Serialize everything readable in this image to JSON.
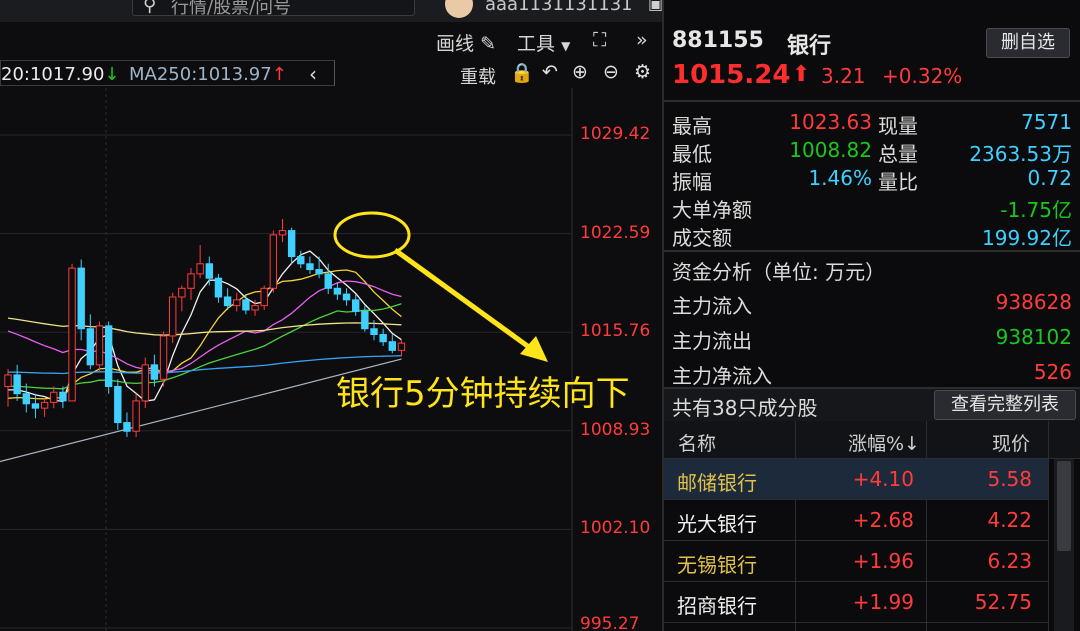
{
  "topbar": {
    "search_placeholder": "行情/股票/问号",
    "username": "aaa1131131131"
  },
  "toolbar": {
    "draw_label": "画线",
    "tools_label": "工具",
    "reload_label": "重载"
  },
  "ma": {
    "ma20_text": "20:1017.90",
    "ma20_arrow": "↓",
    "ma250_text": "MA250:1013.97",
    "ma250_arrow": "↑",
    "prev_icon": "chevron-left-icon"
  },
  "chart": {
    "price_labels": [
      "1029.42",
      "1022.59",
      "1015.76",
      "1008.93",
      "1002.10",
      "995.27"
    ],
    "annotation": "银行5分钟持续向下",
    "annotation_color": "#ffe41a",
    "up_color": "#ff3b3b",
    "down_color": "#3fd0ff"
  },
  "chart_data": {
    "type": "candlestick",
    "ylim": [
      995.27,
      1031.5
    ],
    "y_ticks": [
      1029.42,
      1022.59,
      1015.76,
      1008.93,
      1002.1,
      995.27
    ],
    "candles": [
      [
        1012.0,
        1013.2,
        1010.6,
        1012.8
      ],
      [
        1012.8,
        1013.5,
        1011.0,
        1011.5
      ],
      [
        1011.5,
        1012.2,
        1010.2,
        1010.8
      ],
      [
        1010.8,
        1011.5,
        1009.8,
        1010.5
      ],
      [
        1010.5,
        1011.2,
        1009.9,
        1010.9
      ],
      [
        1010.9,
        1012.0,
        1010.5,
        1011.6
      ],
      [
        1011.6,
        1012.0,
        1010.5,
        1011.0
      ],
      [
        1011.0,
        1020.5,
        1011.0,
        1020.2
      ],
      [
        1020.2,
        1020.8,
        1015.2,
        1016.0
      ],
      [
        1016.0,
        1017.0,
        1013.2,
        1013.5
      ],
      [
        1013.5,
        1016.5,
        1013.0,
        1016.2
      ],
      [
        1016.2,
        1016.5,
        1011.5,
        1012.0
      ],
      [
        1012.0,
        1012.5,
        1009.0,
        1009.5
      ],
      [
        1009.5,
        1010.2,
        1008.5,
        1008.9
      ],
      [
        1008.9,
        1011.5,
        1008.5,
        1011.0
      ],
      [
        1011.0,
        1014.0,
        1010.5,
        1013.5
      ],
      [
        1013.5,
        1014.2,
        1012.0,
        1012.5
      ],
      [
        1012.5,
        1015.8,
        1012.0,
        1015.5
      ],
      [
        1015.5,
        1018.5,
        1015.0,
        1018.2
      ],
      [
        1018.2,
        1019.0,
        1017.2,
        1018.8
      ],
      [
        1018.8,
        1020.2,
        1018.0,
        1019.8
      ],
      [
        1019.8,
        1021.8,
        1019.5,
        1020.5
      ],
      [
        1020.5,
        1021.0,
        1019.0,
        1019.5
      ],
      [
        1019.5,
        1019.8,
        1017.8,
        1018.2
      ],
      [
        1018.2,
        1018.8,
        1017.3,
        1017.6
      ],
      [
        1017.6,
        1018.5,
        1017.2,
        1018.0
      ],
      [
        1018.0,
        1018.4,
        1017.0,
        1017.3
      ],
      [
        1017.3,
        1018.0,
        1016.9,
        1017.6
      ],
      [
        1017.6,
        1019.0,
        1017.3,
        1018.8
      ],
      [
        1018.8,
        1022.8,
        1018.5,
        1022.5
      ],
      [
        1022.5,
        1023.6,
        1022.0,
        1022.8
      ],
      [
        1022.8,
        1023.0,
        1020.5,
        1021.0
      ],
      [
        1021.0,
        1021.4,
        1020.2,
        1020.5
      ],
      [
        1020.5,
        1021.0,
        1019.8,
        1020.1
      ],
      [
        1020.1,
        1021.0,
        1019.5,
        1019.8
      ],
      [
        1019.8,
        1020.5,
        1018.4,
        1018.8
      ],
      [
        1018.8,
        1019.2,
        1018.0,
        1018.4
      ],
      [
        1018.4,
        1018.8,
        1017.6,
        1018.0
      ],
      [
        1018.0,
        1018.4,
        1016.9,
        1017.2
      ],
      [
        1017.2,
        1017.6,
        1015.8,
        1016.0
      ],
      [
        1016.0,
        1016.6,
        1015.2,
        1015.6
      ],
      [
        1015.6,
        1016.0,
        1014.8,
        1015.1
      ],
      [
        1015.1,
        1015.6,
        1014.3,
        1014.5
      ],
      [
        1014.5,
        1015.2,
        1014.1,
        1015.0
      ]
    ]
  },
  "quote": {
    "code": "881155",
    "name": "银行",
    "del_button": "删自选",
    "price": "1015.24",
    "arrow": "⬆",
    "change": "3.21",
    "pct": "+0.32%"
  },
  "stats": [
    {
      "k1": "最高",
      "v1": "1023.63",
      "c1": "red",
      "k2": "现量",
      "v2": "7571",
      "c2": "cyan"
    },
    {
      "k1": "最低",
      "v1": "1008.82",
      "c1": "green",
      "k2": "总量",
      "v2": "2363.53万",
      "c2": "cyan"
    },
    {
      "k1": "振幅",
      "v1": "1.46%",
      "c1": "cyan",
      "k2": "量比",
      "v2": "0.72",
      "c2": "cyan"
    }
  ],
  "flow": {
    "big_net_label": "大单净额",
    "big_net_value": "-1.75亿",
    "turnover_label": "成交额",
    "turnover_value": "199.92亿",
    "analysis_title": "资金分析（单位: 万元）",
    "in_label": "主力流入",
    "in_value": "938628",
    "out_label": "主力流出",
    "out_value": "938102",
    "net_label": "主力净流入",
    "net_value": "526"
  },
  "constituents": {
    "title": "共有38只成分股",
    "view_button": "查看完整列表",
    "headers": {
      "name": "名称",
      "change": "涨幅%↓",
      "price": "现价"
    },
    "rows": [
      {
        "name": "邮储银行",
        "change": "+4.10",
        "price": "5.58",
        "name_color": "#e0c24a"
      },
      {
        "name": "光大银行",
        "change": "+2.68",
        "price": "4.22",
        "name_color": "#f0f0f0"
      },
      {
        "name": "无锡银行",
        "change": "+1.96",
        "price": "6.23",
        "name_color": "#e0c24a"
      },
      {
        "name": "招商银行",
        "change": "+1.99",
        "price": "52.75",
        "name_color": "#f0f0f0"
      }
    ]
  }
}
